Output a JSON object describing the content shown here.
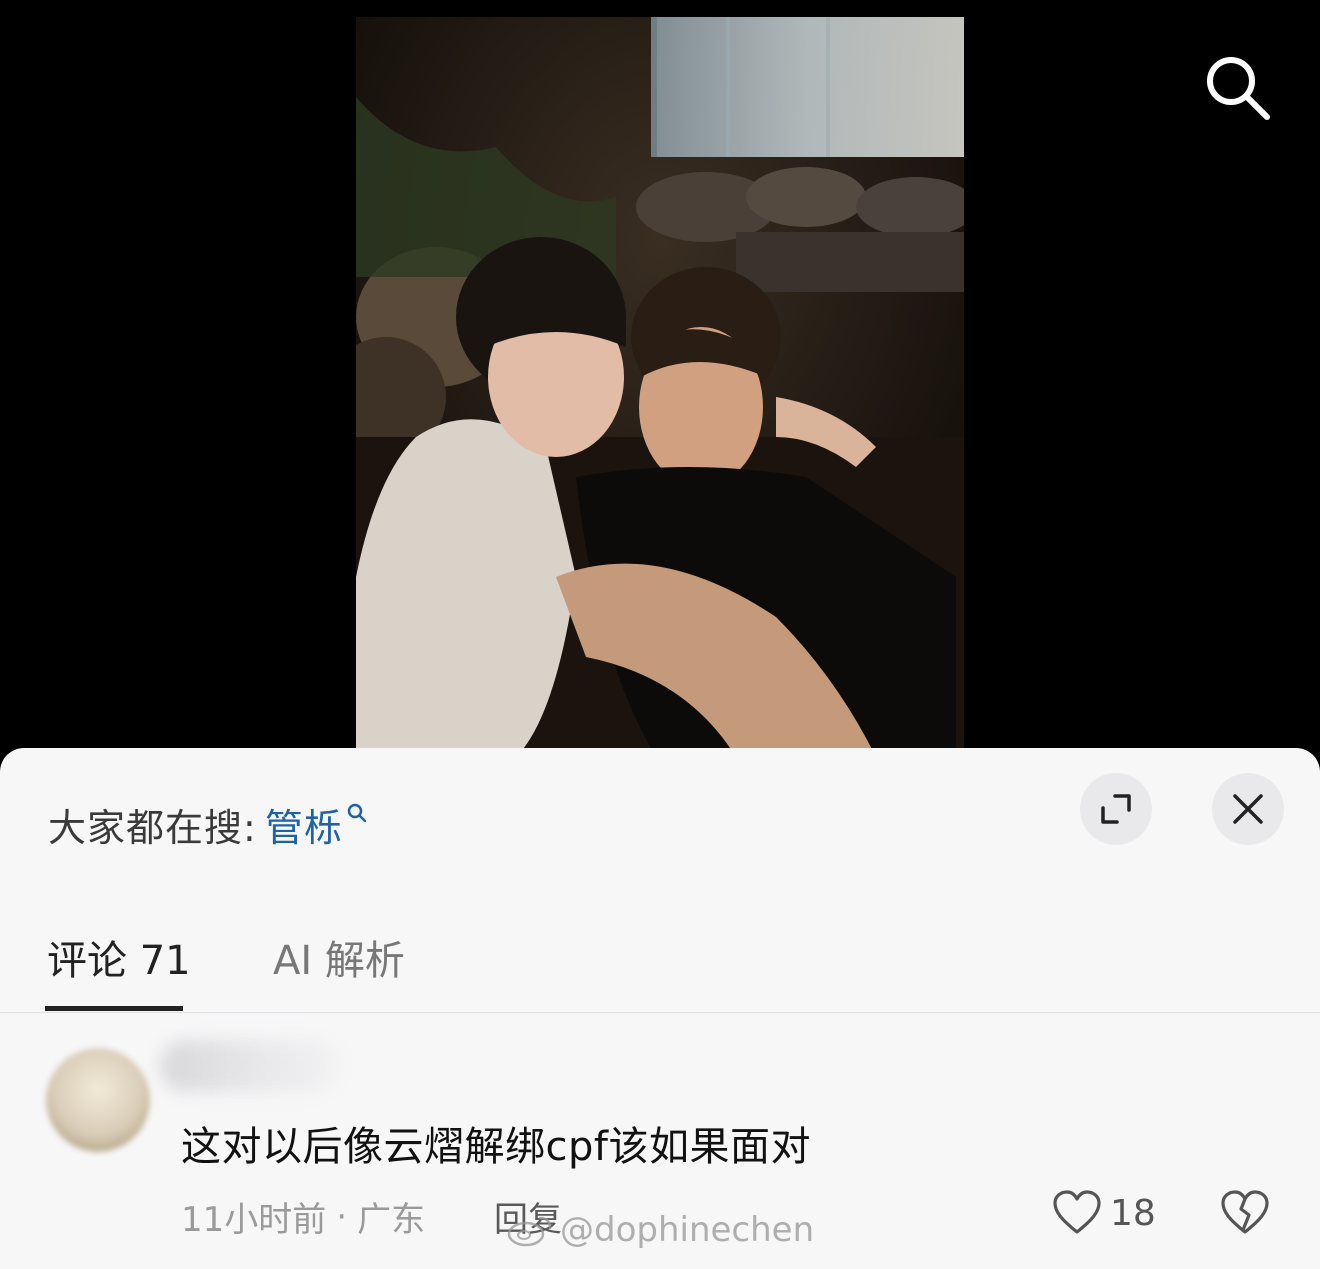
{
  "header": {
    "search_icon": "search-icon"
  },
  "photo": {
    "description_icon": "photo"
  },
  "sheet": {
    "search_hint": {
      "prefix": "大家都在搜:",
      "term": "管栎"
    },
    "expand_icon": "expand-icon",
    "close_icon": "close-icon",
    "tabs": [
      {
        "label": "评论 71",
        "active": true
      },
      {
        "label": "AI 解析",
        "active": false
      }
    ]
  },
  "comments": [
    {
      "text": "这对以后像云熠解绑cpf该如果面对",
      "time": "11小时前",
      "location": "广东",
      "separator": "·",
      "reply_label": "回复",
      "likes": "18"
    }
  ],
  "watermark": {
    "text": "@dophinechen"
  },
  "colors": {
    "sheet_bg": "#f7f7f8",
    "link_blue": "#1f62a8",
    "tab_active": "#222222",
    "tab_inactive": "#777777"
  }
}
